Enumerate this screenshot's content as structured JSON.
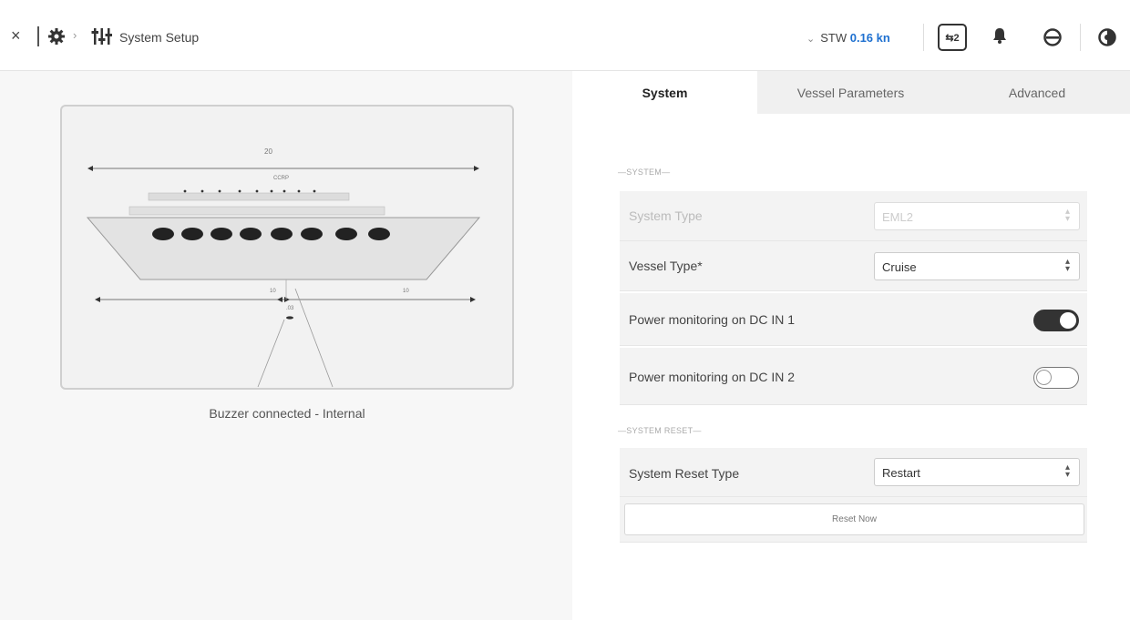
{
  "header": {
    "close_glyph": "×",
    "breadcrumb_separator": "›",
    "title": "System Setup",
    "stw_label": "STW",
    "stw_value": "0.16 kn",
    "device_box_label": "⇆2"
  },
  "vessel_panel": {
    "dim_top": "20",
    "ccrp_label": "CCRP",
    "dim_left": "10",
    "dim_right": "10",
    "dim_center": ".03",
    "status": "Buzzer connected - Internal"
  },
  "tabs": [
    {
      "label": "System",
      "active": true
    },
    {
      "label": "Vessel Parameters",
      "active": false
    },
    {
      "label": "Advanced",
      "active": false
    }
  ],
  "system": {
    "section_label": "—SYSTEM—",
    "system_type": {
      "label": "System Type",
      "value": "EML2",
      "disabled": true
    },
    "vessel_type": {
      "label": "Vessel Type*",
      "value": "Cruise"
    },
    "power_dc1": {
      "label": "Power monitoring on DC IN 1",
      "on": true
    },
    "power_dc2": {
      "label": "Power monitoring on DC IN 2",
      "on": false
    }
  },
  "system_reset": {
    "section_label": "—SYSTEM RESET—",
    "reset_type": {
      "label": "System Reset Type",
      "value": "Restart"
    },
    "reset_button": "Reset Now"
  },
  "colors": {
    "accent": "#1e70d0",
    "toggle_on": "#333333"
  },
  "icons": [
    "close-icon",
    "gear-icon",
    "chevron-right-icon",
    "sliders-icon",
    "chevron-down-icon",
    "bell-icon",
    "user-icon",
    "contrast-icon"
  ]
}
